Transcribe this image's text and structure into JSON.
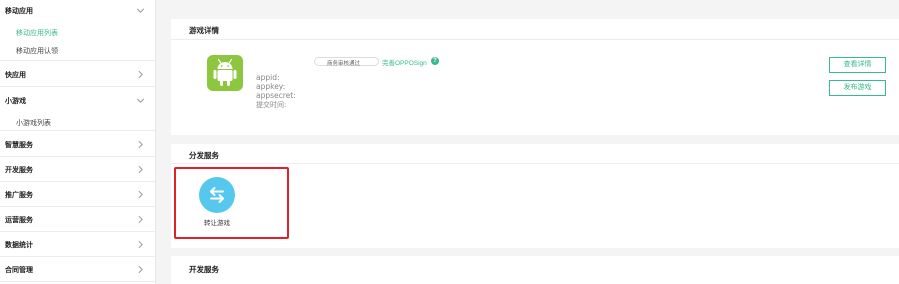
{
  "sidebar": {
    "mobile_apps": {
      "label": "移动应用",
      "children": [
        "移动应用列表",
        "移动应用认领"
      ]
    },
    "quick_app": "快应用",
    "mini_game": {
      "label": "小游戏",
      "children": [
        "小游戏列表"
      ]
    },
    "smart_service": "智慧服务",
    "dev_service": "开发服务",
    "promo_service": "推广服务",
    "ops_service": "运营服务",
    "data_stats": "数据统计",
    "contract_mgmt": "合同管理"
  },
  "game_detail": {
    "title": "游戏详情",
    "appid_label": "appid:",
    "appkey_label": "appkey:",
    "appsecret_label": "appsecret:",
    "submit_time_label": "提交时间:",
    "toggle_label": "商务审核通过",
    "oppo_sign_link": "完善OPPOSign",
    "help_glyph": "?",
    "view_detail_button": "查看详情",
    "publish_button": "发布游戏"
  },
  "distribution": {
    "title": "分发服务",
    "transfer_label": "转让游戏"
  },
  "dev_service_section": {
    "title": "开发服务"
  },
  "colors": {
    "accent": "#3ab98d",
    "android": "#8dc63f",
    "transfer": "#56c8ee",
    "highlight": "#e0202a"
  },
  "icons": [
    "chevron-down-icon",
    "chevron-right-icon",
    "android-icon",
    "transfer-icon",
    "help-icon"
  ]
}
